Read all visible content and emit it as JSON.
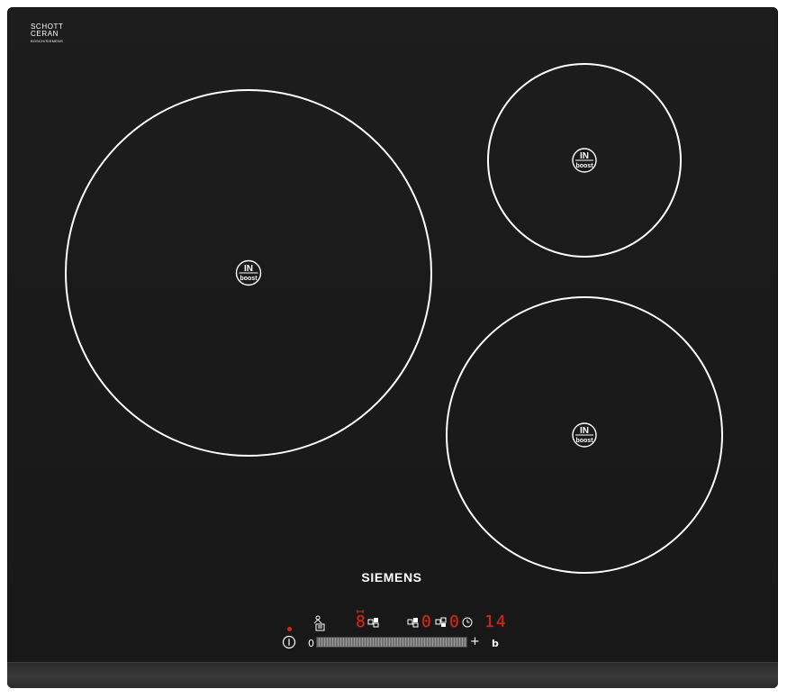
{
  "product": {
    "brand_label": "SIEMENS",
    "glass_logo": {
      "line1": "SCHOTT",
      "line2": "CERAN",
      "line3": "BOSCH/SIEMENS"
    }
  },
  "zones": [
    {
      "id": "large",
      "badge_top": "IN",
      "badge_bottom": "boost"
    },
    {
      "id": "small-right-top",
      "badge_top": "IN",
      "badge_bottom": "boost"
    },
    {
      "id": "medium-right-bottom",
      "badge_top": "IN",
      "badge_bottom": "boost"
    }
  ],
  "control_panel": {
    "slider_min_label": "0",
    "slider_plus_label": "+",
    "slider_boost_label": "b",
    "zone_digit_left": "0",
    "zone_digit_mid": "0",
    "timer_digits": "14",
    "status_digit": "8"
  },
  "colors": {
    "glass": "#1a1a1a",
    "lines": "#ffffff",
    "display_red": "#d3281e"
  },
  "icons": {
    "power": "power-icon",
    "childlock": "child-lock-icon",
    "timer": "timer-clock-icon",
    "zone_select": "zone-select-icon"
  }
}
